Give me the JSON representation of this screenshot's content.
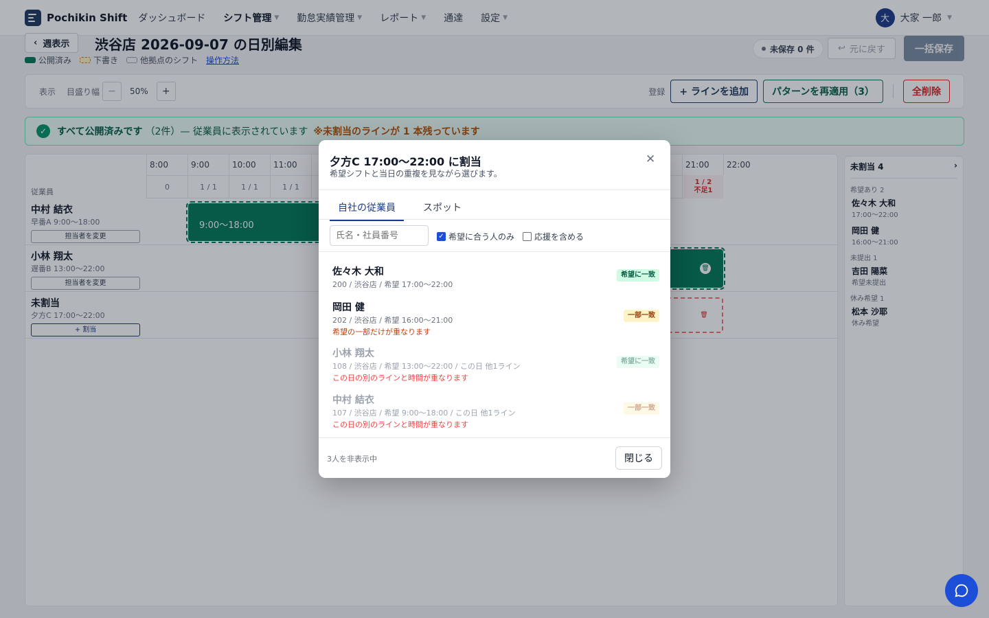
{
  "app": {
    "name": "Pochikin Shift"
  },
  "nav": [
    {
      "label": "ダッシュボード",
      "active": false,
      "dropdown": false
    },
    {
      "label": "シフト管理",
      "active": true,
      "dropdown": true
    },
    {
      "label": "勤怠実績管理",
      "active": false,
      "dropdown": true
    },
    {
      "label": "レポート",
      "active": false,
      "dropdown": true
    },
    {
      "label": "通達",
      "active": false,
      "dropdown": false
    },
    {
      "label": "設定",
      "active": false,
      "dropdown": true
    }
  ],
  "user": {
    "initial": "大",
    "name": "大家 一郎"
  },
  "header": {
    "back_label": "週表示",
    "title": "渋谷店 2026-09-07 の日別編集",
    "legend": {
      "published": "公開済み",
      "draft": "下書き",
      "other": "他拠点のシフト",
      "help": "操作方法"
    },
    "unsaved": "未保存 0 件",
    "undo": "元に戻す",
    "save_all": "一括保存"
  },
  "toolbar": {
    "display": "表示",
    "scale": "目盛り幅",
    "minus": "−",
    "zoom": "50%",
    "plus": "+",
    "register": "登録",
    "add_line": "+ ラインを追加",
    "reapply": "パターンを再適用（3）",
    "delete_all": "全削除"
  },
  "banner": {
    "strong": "すべて公開済みです",
    "text": "（2件）— 従業員に表示されています",
    "warn": "※未割当のラインが 1 本残っています"
  },
  "grid": {
    "col_label": "従業員",
    "hours": [
      "8:00",
      "9:00",
      "10:00",
      "11:00",
      "",
      "",
      "",
      "",
      "",
      "",
      "",
      "",
      "",
      "21:00",
      "22:00"
    ],
    "counts": [
      "0",
      "1 / 1",
      "1 / 1",
      "1 / 1"
    ],
    "shortage": {
      "ratio": "1 / 2",
      "label": "不足1"
    },
    "rows": [
      {
        "name": "中村 結衣",
        "sub": "早番A 9:00〜18:00",
        "button": "担当者を変更"
      },
      {
        "name": "小林 翔太",
        "sub": "遅番B 13:00〜22:00",
        "button": "担当者を変更"
      },
      {
        "name": "未割当",
        "sub": "夕方C 17:00〜22:00",
        "button": "+ 割当"
      }
    ],
    "bar_label": "9:00〜18:00"
  },
  "side": {
    "title": "未割当 4",
    "sections": [
      {
        "label": "希望あり 2",
        "people": [
          {
            "name": "佐々木 大和",
            "sub": "17:00〜22:00"
          },
          {
            "name": "岡田 健",
            "sub": "16:00〜21:00"
          }
        ]
      },
      {
        "label": "未提出 1",
        "people": [
          {
            "name": "吉田 陽菜",
            "sub": "希望未提出"
          }
        ]
      },
      {
        "label": "休み希望 1",
        "people": [
          {
            "name": "松本 沙耶",
            "sub": "休み希望"
          }
        ]
      }
    ]
  },
  "modal": {
    "title": "夕方C 17:00〜22:00 に割当",
    "subtitle": "希望シフトと当日の重複を見ながら選びます。",
    "tabs": [
      "自社の従業員",
      "スポット"
    ],
    "search_placeholder": "氏名・社員番号",
    "filter_match": "希望に合う人のみ",
    "filter_support": "応援を含める",
    "candidates": [
      {
        "name": "佐々木 大和",
        "sub": "200 / 渋谷店 / 希望 17:00〜22:00",
        "warn": "",
        "badge": "希望に一致"
      },
      {
        "name": "岡田 健",
        "sub": "202 / 渋谷店 / 希望 16:00〜21:00",
        "warn": "希望の一部だけが重なります",
        "badge": "一部一致"
      },
      {
        "name": "小林 翔太",
        "sub": "108 / 渋谷店 / 希望 13:00〜22:00 / この日 他1ライン",
        "warn": "この日の別のラインと時間が重なります",
        "badge": "希望に一致"
      },
      {
        "name": "中村 結衣",
        "sub": "107 / 渋谷店 / 希望 9:00〜18:00 / この日 他1ライン",
        "warn": "この日の別のラインと時間が重なります",
        "badge": "一部一致"
      }
    ],
    "hidden_count": "3人を非表示中",
    "close": "閉じる"
  }
}
